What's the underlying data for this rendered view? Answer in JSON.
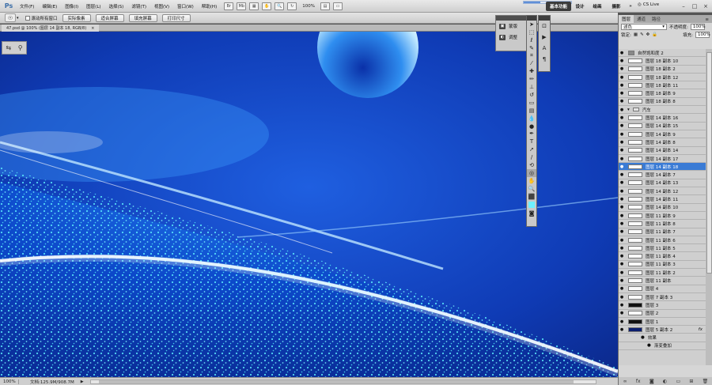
{
  "app": {
    "logo": "Ps"
  },
  "menu": [
    "文件(F)",
    "编辑(E)",
    "图像(I)",
    "图层(L)",
    "选择(S)",
    "滤镜(T)",
    "视图(V)",
    "窗口(W)",
    "帮助(H)"
  ],
  "menubar": {
    "zoom": "100%",
    "workspaces": [
      "基本功能",
      "设计",
      "绘画",
      "摄影"
    ],
    "cs_live": "CS Live",
    "progress": 0.35
  },
  "options": {
    "scroll_all_label": "滚动所有窗口",
    "buttons": [
      "实际像素",
      "适合屏幕",
      "填充屏幕",
      "打印尺寸"
    ]
  },
  "document": {
    "tab_title": "47.psd @ 100% (图层 14 副本 18, RGB/8)",
    "close": "×"
  },
  "status": {
    "zoom": "100%",
    "info": "文档:125.9M/908.7M"
  },
  "adjust_panel": {
    "items": [
      "蒙版",
      "调整"
    ]
  },
  "layers_panel": {
    "tabs": [
      "图层",
      "通道",
      "路径"
    ],
    "blend_mode": "滤色",
    "opacity_label": "不透明度:",
    "opacity": "100%",
    "lock_label": "锁定:",
    "fill_label": "填充:",
    "fill": "100%",
    "layers": [
      {
        "name": "自然饱和度 2",
        "kind": "adjust"
      },
      {
        "name": "图层 18 副本 10",
        "kind": "layer"
      },
      {
        "name": "图层 18 副本 2",
        "kind": "layer"
      },
      {
        "name": "图层 18 副本 12",
        "kind": "layer"
      },
      {
        "name": "图层 18 副本 11",
        "kind": "layer"
      },
      {
        "name": "图层 18 副本 9",
        "kind": "layer"
      },
      {
        "name": "图层 18 副本 8",
        "kind": "layer"
      },
      {
        "name": "汽车",
        "kind": "folder"
      },
      {
        "name": "图层 14 副本 16",
        "kind": "layer"
      },
      {
        "name": "图层 14 副本 15",
        "kind": "layer"
      },
      {
        "name": "图层 14 副本 9",
        "kind": "layer"
      },
      {
        "name": "图层 14 副本 8",
        "kind": "layer"
      },
      {
        "name": "图层 14 副本 14",
        "kind": "layer"
      },
      {
        "name": "图层 14 副本 17",
        "kind": "layer"
      },
      {
        "name": "图层 14 副本 18",
        "kind": "layer",
        "active": true
      },
      {
        "name": "图层 14 副本 7",
        "kind": "layer"
      },
      {
        "name": "图层 14 副本 13",
        "kind": "layer"
      },
      {
        "name": "图层 14 副本 12",
        "kind": "layer"
      },
      {
        "name": "图层 14 副本 11",
        "kind": "layer"
      },
      {
        "name": "图层 14 副本 10",
        "kind": "layer"
      },
      {
        "name": "图层 11 副本 9",
        "kind": "layer"
      },
      {
        "name": "图层 11 副本 8",
        "kind": "layer"
      },
      {
        "name": "图层 11 副本 7",
        "kind": "layer"
      },
      {
        "name": "图层 11 副本 6",
        "kind": "layer"
      },
      {
        "name": "图层 11 副本 5",
        "kind": "layer"
      },
      {
        "name": "图层 11 副本 4",
        "kind": "layer"
      },
      {
        "name": "图层 11 副本 3",
        "kind": "layer"
      },
      {
        "name": "图层 11 副本 2",
        "kind": "layer"
      },
      {
        "name": "图层 11 副本",
        "kind": "layer"
      },
      {
        "name": "图层 4",
        "kind": "layer"
      },
      {
        "name": "图层 7 副本 3",
        "kind": "layer"
      },
      {
        "name": "图层 3",
        "kind": "mask"
      },
      {
        "name": "图层 2",
        "kind": "layer"
      },
      {
        "name": "图层 1",
        "kind": "mask"
      },
      {
        "name": "图层 5 副本 2",
        "kind": "navy",
        "fx": "fx"
      },
      {
        "name": "效果",
        "kind": "effect"
      },
      {
        "name": "渐变叠加",
        "kind": "effect2"
      }
    ]
  },
  "icons": {
    "visibility": "eye-icon",
    "tool_move": "move-icon",
    "zoom_tool": "zoom-icon"
  }
}
